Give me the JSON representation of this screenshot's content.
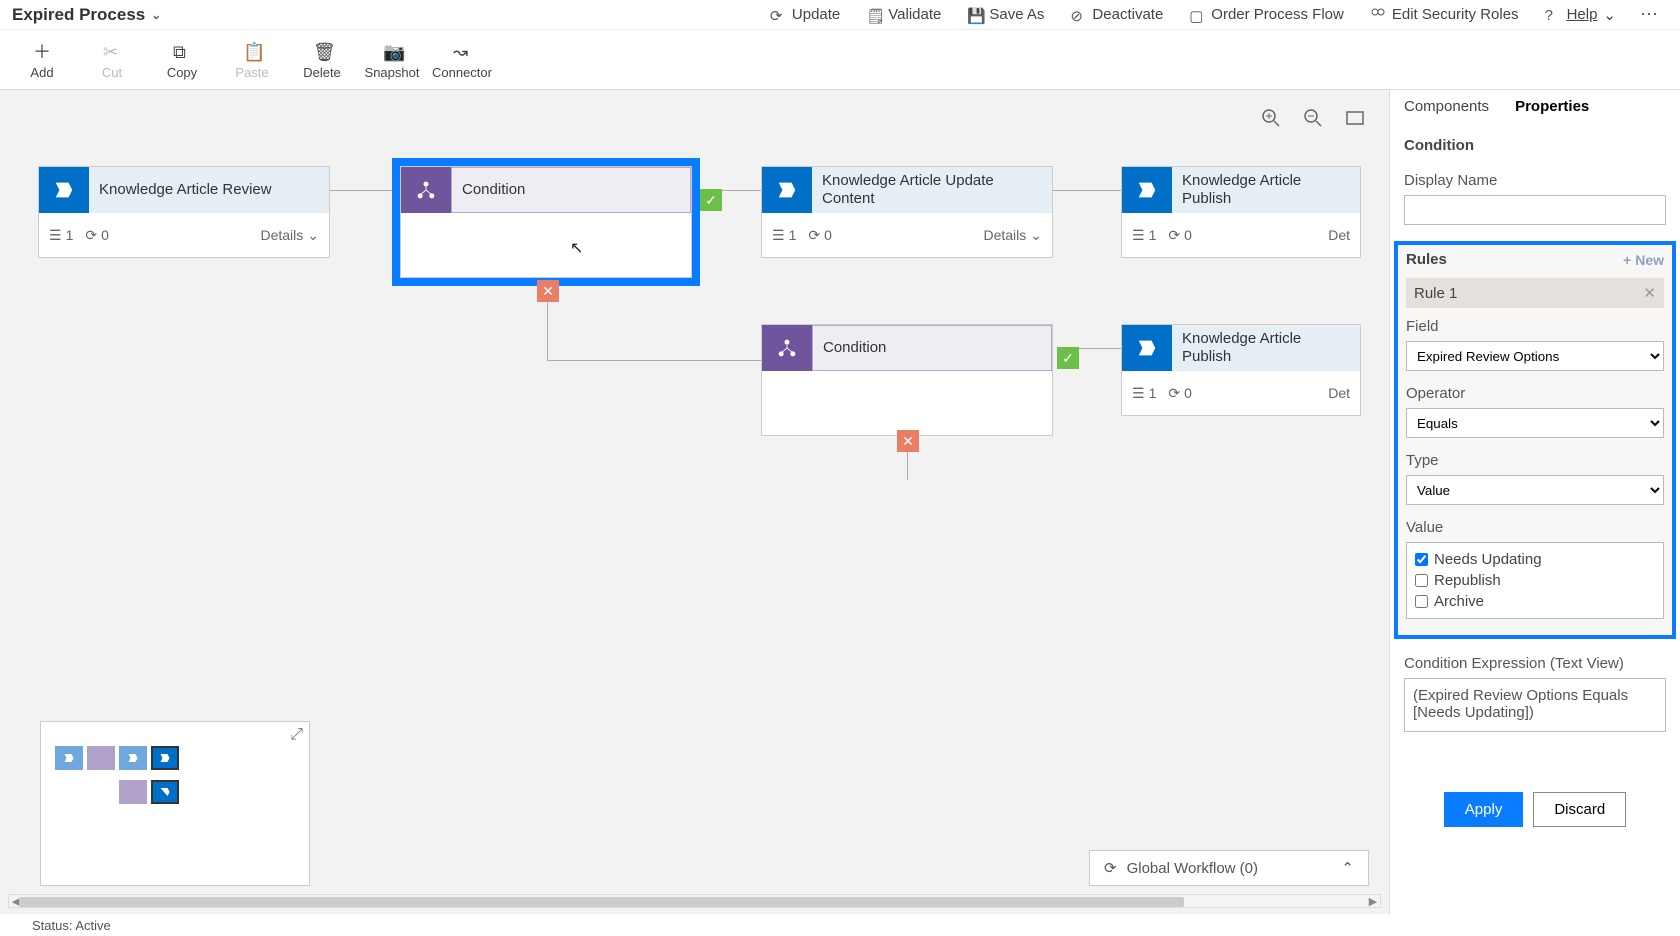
{
  "title": "Expired Process",
  "topActions": {
    "update": "Update",
    "validate": "Validate",
    "saveAs": "Save As",
    "deactivate": "Deactivate",
    "orderProcessFlow": "Order Process Flow",
    "editSecurity": "Edit Security Roles",
    "help": "Help"
  },
  "editToolbar": {
    "add": "Add",
    "cut": "Cut",
    "copy": "Copy",
    "paste": "Paste",
    "delete": "Delete",
    "snapshot": "Snapshot",
    "connector": "Connector"
  },
  "stages": {
    "s1": {
      "title": "Knowledge Article Review",
      "steps": "1",
      "refresh": "0",
      "details": "Details"
    },
    "c1": {
      "title": "Condition"
    },
    "s2": {
      "title": "Knowledge Article Update Content",
      "steps": "1",
      "refresh": "0",
      "details": "Details"
    },
    "s3": {
      "title": "Knowledge Article Publish",
      "steps": "1",
      "refresh": "0",
      "details": "Det"
    },
    "c2": {
      "title": "Condition"
    },
    "s4": {
      "title": "Knowledge Article Publish",
      "steps": "1",
      "refresh": "0",
      "details": "Det"
    }
  },
  "globalWorkflow": "Global Workflow (0)",
  "rightPanel": {
    "tabs": {
      "components": "Components",
      "properties": "Properties"
    },
    "heading": "Condition",
    "displayNameLabel": "Display Name",
    "displayNameValue": "",
    "rulesLabel": "Rules",
    "newLabel": "+ New",
    "ruleTitle": "Rule 1",
    "fieldLabel": "Field",
    "fieldValue": "Expired Review Options",
    "operatorLabel": "Operator",
    "operatorValue": "Equals",
    "typeLabel": "Type",
    "typeValue": "Value",
    "valueLabel": "Value",
    "valueOptions": {
      "opt1": "Needs Updating",
      "opt2": "Republish",
      "opt3": "Archive"
    },
    "condExprLabel": "Condition Expression (Text View)",
    "condExprValue": "(Expired Review Options Equals [Needs Updating])",
    "apply": "Apply",
    "discard": "Discard"
  },
  "status": "Status: Active"
}
